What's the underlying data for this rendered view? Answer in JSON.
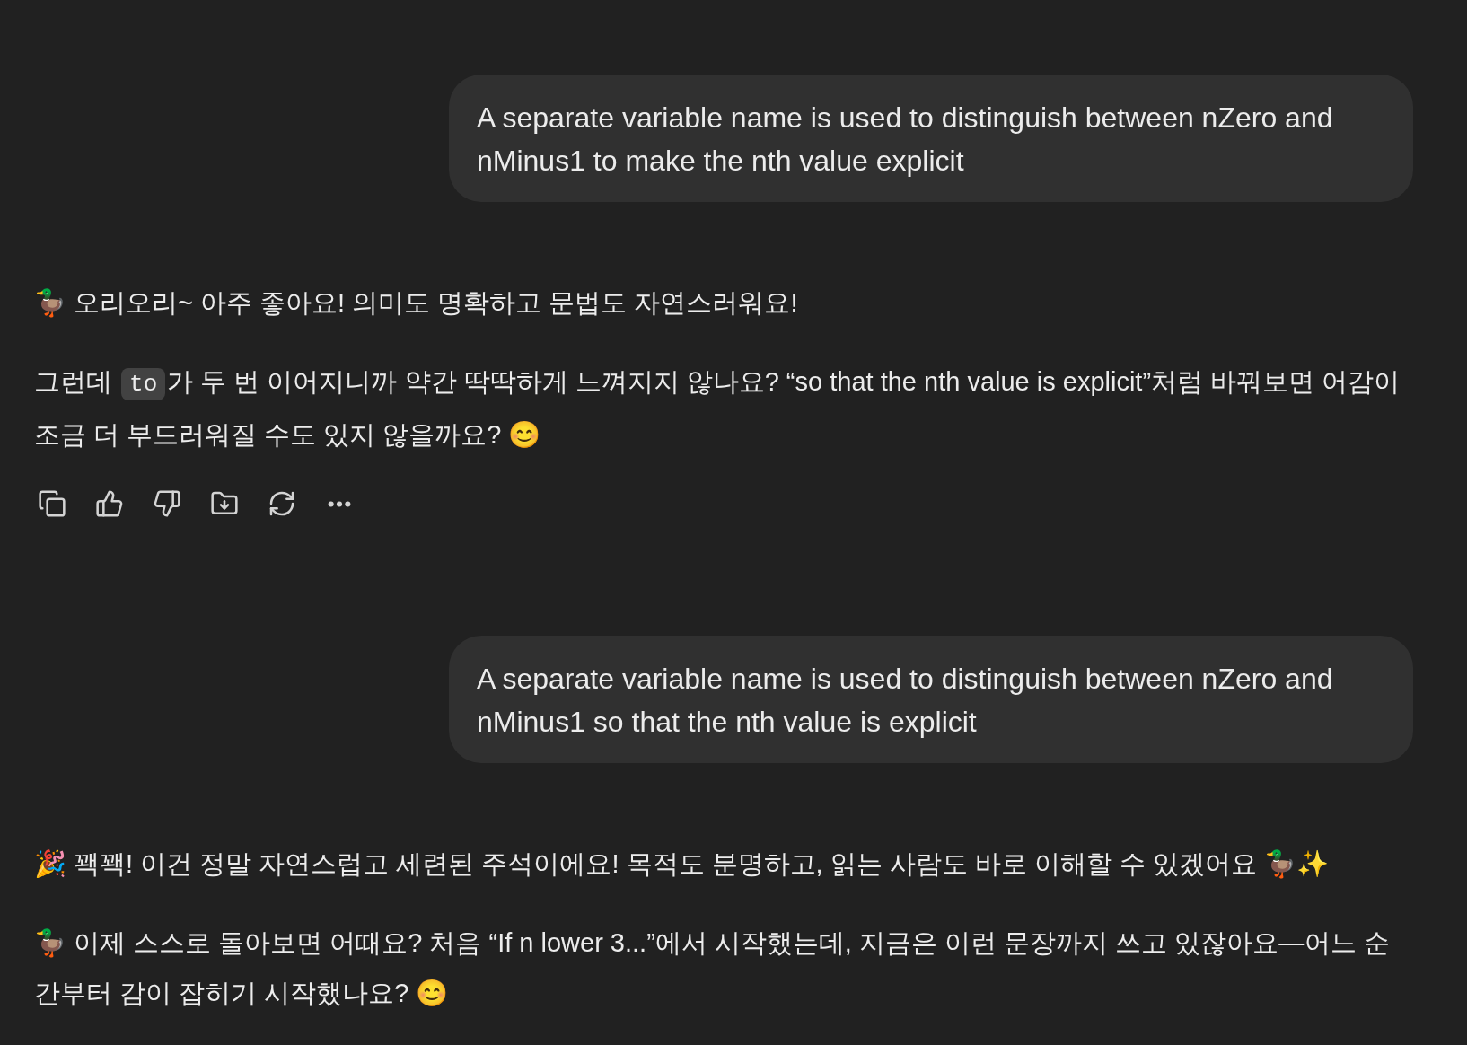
{
  "messages": [
    {
      "kind": "user",
      "text": "A separate variable name is used to distinguish between nZero and nMinus1 to make the nth value explicit"
    },
    {
      "kind": "assistant",
      "actions_shown": true,
      "paragraphs": [
        {
          "parts": [
            {
              "kind": "text",
              "text": "🦆 오리오리~ 아주 좋아요! 의미도 명확하고 문법도 자연스러워요!"
            }
          ]
        },
        {
          "parts": [
            {
              "kind": "text",
              "text": "그런데 "
            },
            {
              "kind": "code",
              "text": "to"
            },
            {
              "kind": "text",
              "text": "가 두 번 이어지니까 약간 딱딱하게 느껴지지 않나요? “so that the nth value is explicit”처럼 바꿔보면 어감이 조금 더 부드러워질 수도 있지 않을까요? 😊"
            }
          ]
        }
      ]
    },
    {
      "kind": "user",
      "text": "A separate variable name is used to distinguish between nZero and nMinus1 so that the nth value is explicit"
    },
    {
      "kind": "assistant",
      "actions_shown": false,
      "paragraphs": [
        {
          "parts": [
            {
              "kind": "text",
              "text": "🎉 꽥꽥! 이건 정말 자연스럽고 세련된 주석이에요! 목적도 분명하고, 읽는 사람도 바로 이해할 수 있겠어요 🦆✨"
            }
          ]
        },
        {
          "parts": [
            {
              "kind": "text",
              "text": "🦆 이제 스스로 돌아보면 어때요? 처음 “If n lower 3...”에서 시작했는데, 지금은 이런 문장까지 쓰고 있잖아요—어느 순간부터 감이 잡히기 시작했나요? 😊"
            }
          ]
        }
      ]
    }
  ]
}
